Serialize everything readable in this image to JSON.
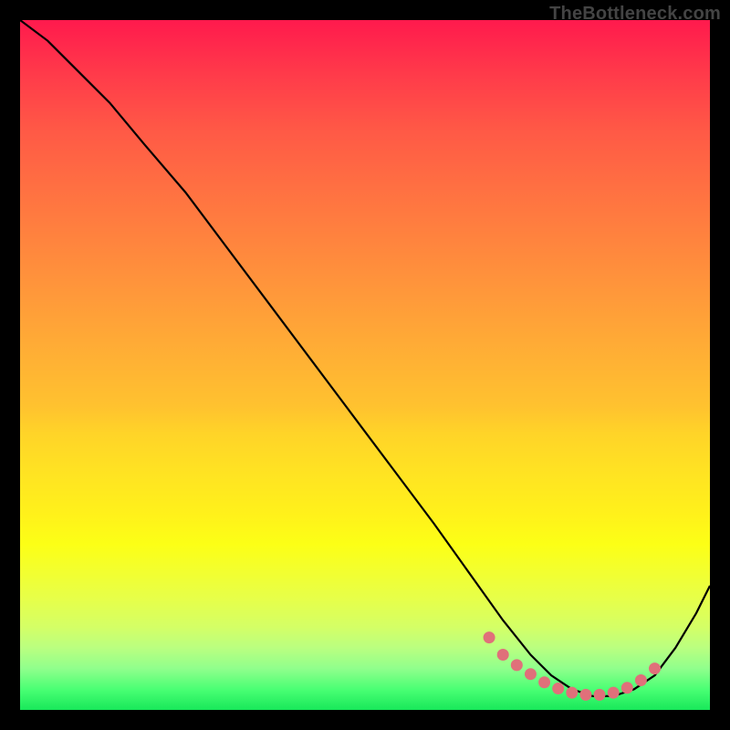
{
  "watermark": "TheBottleneck.com",
  "chart_data": {
    "type": "line",
    "title": "",
    "xlabel": "",
    "ylabel": "",
    "xlim": [
      0,
      100
    ],
    "ylim": [
      0,
      100
    ],
    "series": [
      {
        "name": "bottleneck-curve",
        "x": [
          0,
          4,
          8,
          13,
          18,
          24,
          30,
          36,
          42,
          48,
          54,
          60,
          65,
          70,
          74,
          77,
          80,
          83,
          86,
          89,
          92,
          95,
          98,
          100
        ],
        "y": [
          100,
          97,
          93,
          88,
          82,
          75,
          67,
          59,
          51,
          43,
          35,
          27,
          20,
          13,
          8,
          5,
          3,
          2,
          2,
          3,
          5,
          9,
          14,
          18
        ]
      }
    ],
    "highlight_points": {
      "name": "optimal-range",
      "color": "#e0707a",
      "x": [
        68,
        70,
        72,
        74,
        76,
        78,
        80,
        82,
        84,
        86,
        88,
        90,
        92
      ],
      "y": [
        10.5,
        8,
        6.5,
        5.2,
        4.0,
        3.1,
        2.5,
        2.2,
        2.2,
        2.5,
        3.2,
        4.3,
        6.0
      ]
    },
    "gradient_stops": [
      {
        "pos": 0.0,
        "color": "#ff1a4d"
      },
      {
        "pos": 0.5,
        "color": "#ffb030"
      },
      {
        "pos": 0.8,
        "color": "#f7ff20"
      },
      {
        "pos": 1.0,
        "color": "#18e85a"
      }
    ]
  }
}
